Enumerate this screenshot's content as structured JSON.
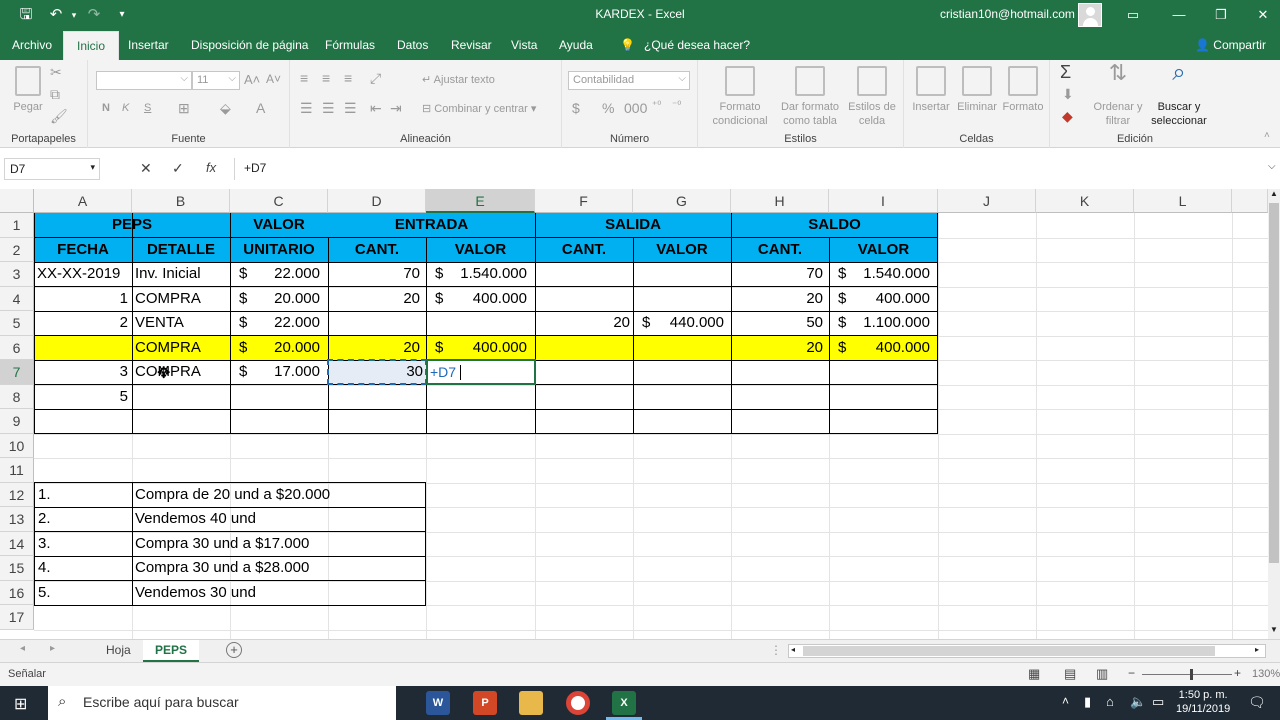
{
  "window": {
    "title": "KARDEX  -  Excel",
    "user": "cristian10n@hotmail.com"
  },
  "tabs": [
    "Archivo",
    "Inicio",
    "Insertar",
    "Disposición de página",
    "Fórmulas",
    "Datos",
    "Revisar",
    "Vista",
    "Ayuda",
    "¿Qué desea hacer?"
  ],
  "share": "Compartir",
  "ribbon": {
    "pegar": "Pegar",
    "portapapeles": "Portapapeles",
    "fuente": "Fuente",
    "font_size": "11",
    "bold": "N",
    "italic": "K",
    "underline": "S",
    "ajustar_texto": "Ajustar texto",
    "combinar": "Combinar y centrar",
    "alineacion": "Alineación",
    "number_format": "Contabilidad",
    "numero": "Número",
    "formato_condicional": "Formato condicional",
    "dar_formato": "Dar formato como tabla",
    "estilos_celda": "Estilos de celda",
    "estilos": "Estilos",
    "insertar": "Insertar",
    "eliminar": "Eliminar",
    "formato": "Formato",
    "celdas": "Celdas",
    "ordenar": "Ordenar y filtrar",
    "buscar": "Buscar y seleccionar",
    "edicion": "Edición"
  },
  "formula_bar": {
    "name_box": "D7",
    "formula": "+D7"
  },
  "columns": [
    "A",
    "B",
    "C",
    "D",
    "E",
    "F",
    "G",
    "H",
    "I",
    "J",
    "K",
    "L"
  ],
  "rows": [
    "1",
    "2",
    "3",
    "4",
    "5",
    "6",
    "7",
    "8",
    "9",
    "10",
    "11",
    "12",
    "13",
    "14",
    "15",
    "16",
    "17"
  ],
  "sheet": {
    "header1": {
      "peps": "PEPS",
      "valor": "VALOR",
      "entrada": "ENTRADA",
      "salida": "SALIDA",
      "saldo": "SALDO"
    },
    "header2": {
      "fecha": "FECHA",
      "detalle": "DETALLE",
      "unitario": "UNITARIO",
      "cant_e": "CANT.",
      "valor_e": "VALOR",
      "cant_s": "CANT.",
      "valor_s": "VALOR",
      "cant_sa": "CANT.",
      "valor_sa": "VALOR"
    },
    "r3": {
      "a": "XX-XX-2019",
      "b": "Inv. Inicial",
      "c_sym": "$",
      "c": "22.000",
      "d": "70",
      "e_sym": "$",
      "e": "1.540.000",
      "h": "70",
      "i_sym": "$",
      "i": "1.540.000"
    },
    "r4": {
      "a": "1",
      "b": "COMPRA",
      "c_sym": "$",
      "c": "20.000",
      "d": "20",
      "e_sym": "$",
      "e": "400.000",
      "h": "20",
      "i_sym": "$",
      "i": "400.000"
    },
    "r5": {
      "a": "2",
      "b": "VENTA",
      "c_sym": "$",
      "c": "22.000",
      "f": "20",
      "g_sym": "$",
      "g": "440.000",
      "h": "50",
      "i_sym": "$",
      "i": "1.100.000"
    },
    "r6": {
      "b": "COMPRA",
      "c_sym": "$",
      "c": "20.000",
      "d": "20",
      "e_sym": "$",
      "e": "400.000",
      "h": "20",
      "i_sym": "$",
      "i": "400.000"
    },
    "r7": {
      "a": "3",
      "b": "COMPRA",
      "c_sym": "$",
      "c": "17.000",
      "d": "30",
      "e": "+D7"
    },
    "r8": {
      "a": "5"
    },
    "notes": [
      {
        "n": "1.",
        "t": "Compra de 20 und a $20.000"
      },
      {
        "n": "2.",
        "t": "Vendemos 40 und"
      },
      {
        "n": "3.",
        "t": "Compra 30 und a $17.000"
      },
      {
        "n": "4.",
        "t": "Compra 30 und a $28.000"
      },
      {
        "n": "5.",
        "t": "Vendemos 30 und"
      }
    ]
  },
  "sheet_tabs": [
    "Hoja",
    "PEPS"
  ],
  "status": {
    "mode": "Señalar",
    "zoom": "130%"
  },
  "taskbar": {
    "search": "Escribe aquí para buscar",
    "time": "1:50 p. m.",
    "date": "19/11/2019"
  }
}
